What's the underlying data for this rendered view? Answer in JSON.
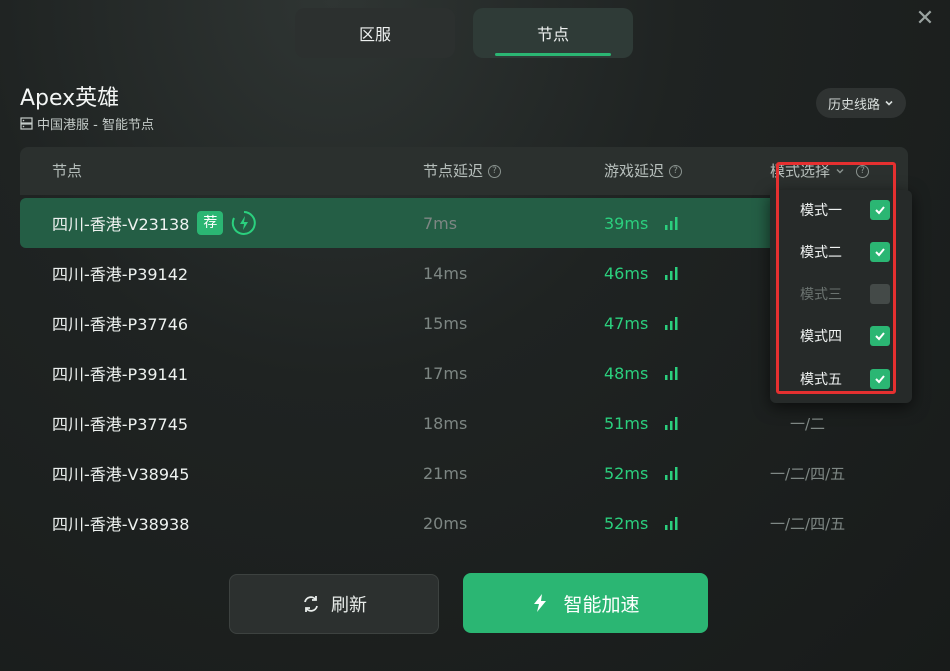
{
  "tabs": [
    {
      "label": "区服",
      "active": false
    },
    {
      "label": "节点",
      "active": true
    }
  ],
  "close_icon": "✕",
  "game": {
    "title": "Apex英雄",
    "subtitle": "中国港服 - 智能节点"
  },
  "history_button": {
    "label": "历史线路",
    "icon": "chevron-down-icon"
  },
  "table": {
    "headers": {
      "node": "节点",
      "node_latency": "节点延迟",
      "game_latency": "游戏延迟",
      "mode_select": "模式选择"
    },
    "rows": [
      {
        "name": "四川-香港-V23138",
        "recommended": "荐",
        "latency": "7ms",
        "game_latency": "39ms",
        "modes": ""
      },
      {
        "name": "四川-香港-P39142",
        "latency": "14ms",
        "game_latency": "46ms",
        "modes": ""
      },
      {
        "name": "四川-香港-P37746",
        "latency": "15ms",
        "game_latency": "47ms",
        "modes": ""
      },
      {
        "name": "四川-香港-P39141",
        "latency": "17ms",
        "game_latency": "48ms",
        "modes": ""
      },
      {
        "name": "四川-香港-P37745",
        "latency": "18ms",
        "game_latency": "51ms",
        "modes": "一/二"
      },
      {
        "name": "四川-香港-V38945",
        "latency": "21ms",
        "game_latency": "52ms",
        "modes": "一/二/四/五"
      },
      {
        "name": "四川-香港-V38938",
        "latency": "20ms",
        "game_latency": "52ms",
        "modes": "一/二/四/五"
      }
    ]
  },
  "mode_dropdown": {
    "items": [
      {
        "label": "模式一",
        "checked": true,
        "enabled": true
      },
      {
        "label": "模式二",
        "checked": true,
        "enabled": true
      },
      {
        "label": "模式三",
        "checked": false,
        "enabled": false
      },
      {
        "label": "模式四",
        "checked": true,
        "enabled": true
      },
      {
        "label": "模式五",
        "checked": true,
        "enabled": true
      }
    ]
  },
  "buttons": {
    "refresh": "刷新",
    "smart_boost": "智能加速"
  },
  "colors": {
    "accent": "#2bb673",
    "game_latency": "#2bd07e",
    "highlight_box": "#e53030"
  }
}
